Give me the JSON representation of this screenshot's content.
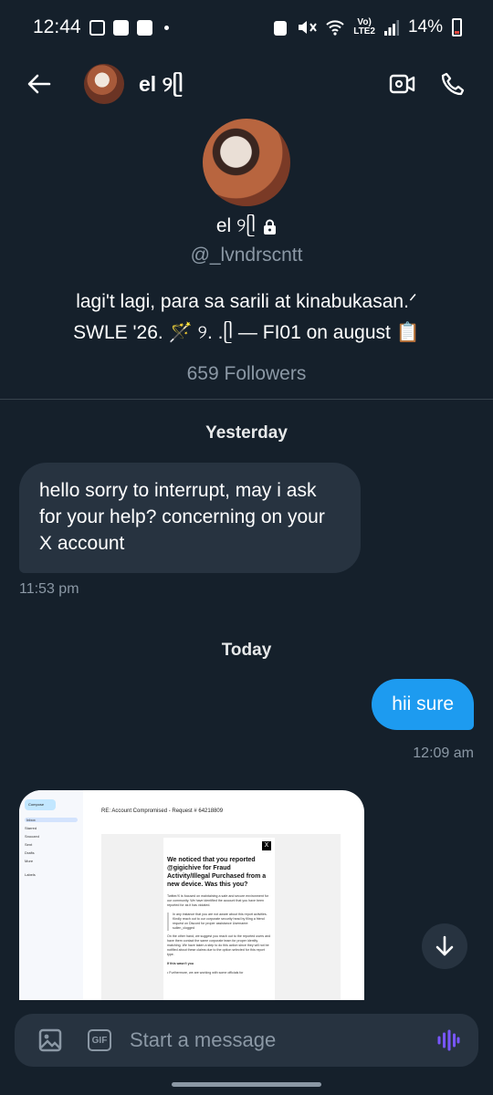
{
  "status_bar": {
    "time": "12:44",
    "battery": "14%",
    "lte_top": "Vo)",
    "lte_bottom": "LTE2"
  },
  "header": {
    "name": "el ୨ᥫ"
  },
  "profile": {
    "name": "el ୨ᥫ",
    "handle": "@_lvndrscntt",
    "bio_line1": "lagi't lagi, para sa sarili at kinabukasan.ᐟ",
    "bio_line2": "SWLE '26. 🪄 ୨. .ᥫ — FI01 on august 📋",
    "followers": "659 Followers"
  },
  "messages": {
    "day1": "Yesterday",
    "msg1": "hello sorry to interrupt, may i ask for your help? concerning on your X account",
    "msg1_time": "11:53 pm",
    "day2": "Today",
    "msg2": "hii sure",
    "msg2_time": "12:09 am"
  },
  "attachment": {
    "compose": "Compose",
    "nav": [
      "Inbox",
      "Starred",
      "Snoozed",
      "Sent",
      "Drafts",
      "More"
    ],
    "labels": "Labels",
    "subject": "RE: Account Compromised - Request # 64218809",
    "title": "We noticed that you reported @gigichive for Fraud Activity/Illegal Purchased from a new device. Was this you?",
    "body1": "Twitter/X is focused on maintaining a safe and secure environment for our community. We have identified the account that you have been reported for as it has violated.",
    "body2": "In any instance that you are not aware about this report activities. Kindly reach out to our corporate security head by filing a friend request on Discord for proper assistance Username: sullen_clogged",
    "body3": "On the other hand, we suggest you reach out to the reported users and have them contact the same corporate team for proper identity matching. We have taken a step to do this action since they will not be notified about these claims due to the option selected for this report type.",
    "body4": "If this wasn't you",
    "body5": "• Furthermore, we are working with some officials for"
  },
  "composer": {
    "placeholder": "Start a message",
    "gif_label": "GIF"
  },
  "colors": {
    "bg": "#15202b",
    "bubble_in": "#273340",
    "bubble_out": "#1d9bf0",
    "muted": "#8b98a5",
    "voice": "#7856ff"
  }
}
